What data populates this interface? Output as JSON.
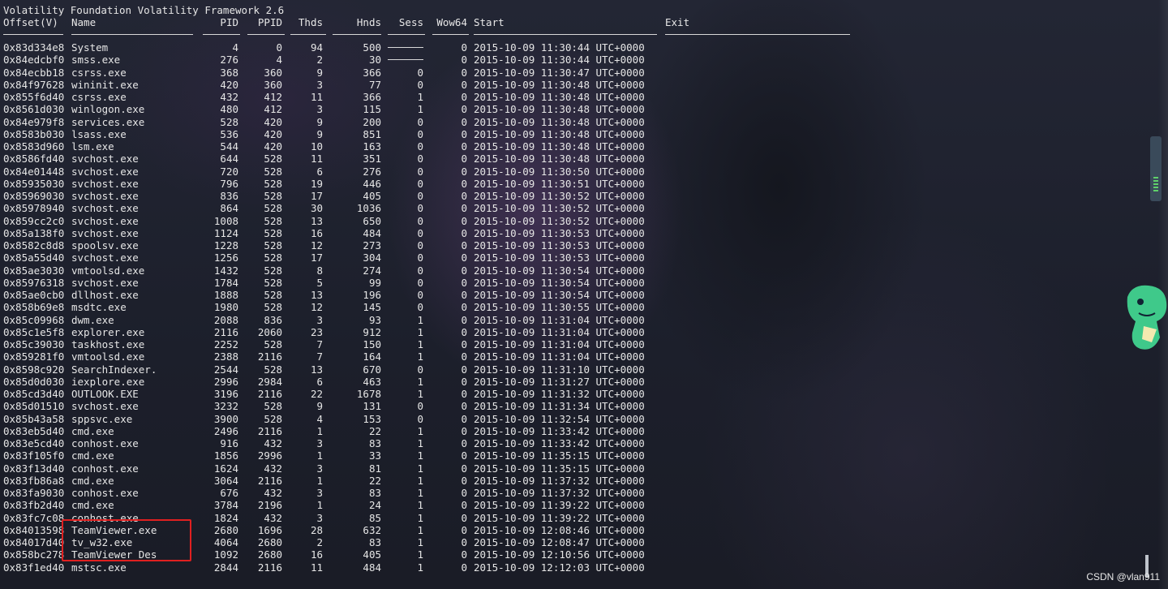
{
  "title_line": "Volatility Foundation Volatility Framework 2.6",
  "columns": [
    "Offset(V)",
    "Name",
    "PID",
    "PPID",
    "Thds",
    "Hnds",
    "Sess",
    "Wow64",
    "Start",
    "Exit"
  ],
  "rows": [
    [
      "0x83d334e8",
      "System",
      "4",
      "0",
      "94",
      "500",
      "",
      "0",
      "2015-10-09 11:30:44 UTC+0000"
    ],
    [
      "0x84edcbf0",
      "smss.exe",
      "276",
      "4",
      "2",
      "30",
      "",
      "0",
      "2015-10-09 11:30:44 UTC+0000"
    ],
    [
      "0x84ecbb18",
      "csrss.exe",
      "368",
      "360",
      "9",
      "366",
      "0",
      "0",
      "2015-10-09 11:30:47 UTC+0000"
    ],
    [
      "0x84f97628",
      "wininit.exe",
      "420",
      "360",
      "3",
      "77",
      "0",
      "0",
      "2015-10-09 11:30:48 UTC+0000"
    ],
    [
      "0x855f6d40",
      "csrss.exe",
      "432",
      "412",
      "11",
      "366",
      "1",
      "0",
      "2015-10-09 11:30:48 UTC+0000"
    ],
    [
      "0x8561d030",
      "winlogon.exe",
      "480",
      "412",
      "3",
      "115",
      "1",
      "0",
      "2015-10-09 11:30:48 UTC+0000"
    ],
    [
      "0x84e979f8",
      "services.exe",
      "528",
      "420",
      "9",
      "200",
      "0",
      "0",
      "2015-10-09 11:30:48 UTC+0000"
    ],
    [
      "0x8583b030",
      "lsass.exe",
      "536",
      "420",
      "9",
      "851",
      "0",
      "0",
      "2015-10-09 11:30:48 UTC+0000"
    ],
    [
      "0x8583d960",
      "lsm.exe",
      "544",
      "420",
      "10",
      "163",
      "0",
      "0",
      "2015-10-09 11:30:48 UTC+0000"
    ],
    [
      "0x8586fd40",
      "svchost.exe",
      "644",
      "528",
      "11",
      "351",
      "0",
      "0",
      "2015-10-09 11:30:48 UTC+0000"
    ],
    [
      "0x84e01448",
      "svchost.exe",
      "720",
      "528",
      "6",
      "276",
      "0",
      "0",
      "2015-10-09 11:30:50 UTC+0000"
    ],
    [
      "0x85935030",
      "svchost.exe",
      "796",
      "528",
      "19",
      "446",
      "0",
      "0",
      "2015-10-09 11:30:51 UTC+0000"
    ],
    [
      "0x85969030",
      "svchost.exe",
      "836",
      "528",
      "17",
      "405",
      "0",
      "0",
      "2015-10-09 11:30:52 UTC+0000"
    ],
    [
      "0x85978940",
      "svchost.exe",
      "864",
      "528",
      "30",
      "1036",
      "0",
      "0",
      "2015-10-09 11:30:52 UTC+0000"
    ],
    [
      "0x859cc2c0",
      "svchost.exe",
      "1008",
      "528",
      "13",
      "650",
      "0",
      "0",
      "2015-10-09 11:30:52 UTC+0000"
    ],
    [
      "0x85a138f0",
      "svchost.exe",
      "1124",
      "528",
      "16",
      "484",
      "0",
      "0",
      "2015-10-09 11:30:53 UTC+0000"
    ],
    [
      "0x8582c8d8",
      "spoolsv.exe",
      "1228",
      "528",
      "12",
      "273",
      "0",
      "0",
      "2015-10-09 11:30:53 UTC+0000"
    ],
    [
      "0x85a55d40",
      "svchost.exe",
      "1256",
      "528",
      "17",
      "304",
      "0",
      "0",
      "2015-10-09 11:30:53 UTC+0000"
    ],
    [
      "0x85ae3030",
      "vmtoolsd.exe",
      "1432",
      "528",
      "8",
      "274",
      "0",
      "0",
      "2015-10-09 11:30:54 UTC+0000"
    ],
    [
      "0x85976318",
      "svchost.exe",
      "1784",
      "528",
      "5",
      "99",
      "0",
      "0",
      "2015-10-09 11:30:54 UTC+0000"
    ],
    [
      "0x85ae0cb0",
      "dllhost.exe",
      "1888",
      "528",
      "13",
      "196",
      "0",
      "0",
      "2015-10-09 11:30:54 UTC+0000"
    ],
    [
      "0x858b69e8",
      "msdtc.exe",
      "1980",
      "528",
      "12",
      "145",
      "0",
      "0",
      "2015-10-09 11:30:55 UTC+0000"
    ],
    [
      "0x85c09968",
      "dwm.exe",
      "2088",
      "836",
      "3",
      "93",
      "1",
      "0",
      "2015-10-09 11:31:04 UTC+0000"
    ],
    [
      "0x85c1e5f8",
      "explorer.exe",
      "2116",
      "2060",
      "23",
      "912",
      "1",
      "0",
      "2015-10-09 11:31:04 UTC+0000"
    ],
    [
      "0x85c39030",
      "taskhost.exe",
      "2252",
      "528",
      "7",
      "150",
      "1",
      "0",
      "2015-10-09 11:31:04 UTC+0000"
    ],
    [
      "0x859281f0",
      "vmtoolsd.exe",
      "2388",
      "2116",
      "7",
      "164",
      "1",
      "0",
      "2015-10-09 11:31:04 UTC+0000"
    ],
    [
      "0x8598c920",
      "SearchIndexer.",
      "2544",
      "528",
      "13",
      "670",
      "0",
      "0",
      "2015-10-09 11:31:10 UTC+0000"
    ],
    [
      "0x85d0d030",
      "iexplore.exe",
      "2996",
      "2984",
      "6",
      "463",
      "1",
      "0",
      "2015-10-09 11:31:27 UTC+0000"
    ],
    [
      "0x85cd3d40",
      "OUTLOOK.EXE",
      "3196",
      "2116",
      "22",
      "1678",
      "1",
      "0",
      "2015-10-09 11:31:32 UTC+0000"
    ],
    [
      "0x85d01510",
      "svchost.exe",
      "3232",
      "528",
      "9",
      "131",
      "0",
      "0",
      "2015-10-09 11:31:34 UTC+0000"
    ],
    [
      "0x85b43a58",
      "sppsvc.exe",
      "3900",
      "528",
      "4",
      "153",
      "0",
      "0",
      "2015-10-09 11:32:54 UTC+0000"
    ],
    [
      "0x83eb5d40",
      "cmd.exe",
      "2496",
      "2116",
      "1",
      "22",
      "1",
      "0",
      "2015-10-09 11:33:42 UTC+0000"
    ],
    [
      "0x83e5cd40",
      "conhost.exe",
      "916",
      "432",
      "3",
      "83",
      "1",
      "0",
      "2015-10-09 11:33:42 UTC+0000"
    ],
    [
      "0x83f105f0",
      "cmd.exe",
      "1856",
      "2996",
      "1",
      "33",
      "1",
      "0",
      "2015-10-09 11:35:15 UTC+0000"
    ],
    [
      "0x83f13d40",
      "conhost.exe",
      "1624",
      "432",
      "3",
      "81",
      "1",
      "0",
      "2015-10-09 11:35:15 UTC+0000"
    ],
    [
      "0x83fb86a8",
      "cmd.exe",
      "3064",
      "2116",
      "1",
      "22",
      "1",
      "0",
      "2015-10-09 11:37:32 UTC+0000"
    ],
    [
      "0x83fa9030",
      "conhost.exe",
      "676",
      "432",
      "3",
      "83",
      "1",
      "0",
      "2015-10-09 11:37:32 UTC+0000"
    ],
    [
      "0x83fb2d40",
      "cmd.exe",
      "3784",
      "2196",
      "1",
      "24",
      "1",
      "0",
      "2015-10-09 11:39:22 UTC+0000"
    ],
    [
      "0x83fc7c08",
      "conhost.exe",
      "1824",
      "432",
      "3",
      "85",
      "1",
      "0",
      "2015-10-09 11:39:22 UTC+0000"
    ],
    [
      "0x84013598",
      "TeamViewer.exe",
      "2680",
      "1696",
      "28",
      "632",
      "1",
      "0",
      "2015-10-09 12:08:46 UTC+0000"
    ],
    [
      "0x84017d40",
      "tv_w32.exe",
      "4064",
      "2680",
      "2",
      "83",
      "1",
      "0",
      "2015-10-09 12:08:47 UTC+0000"
    ],
    [
      "0x858bc278",
      "TeamViewer_Des",
      "1092",
      "2680",
      "16",
      "405",
      "1",
      "0",
      "2015-10-09 12:10:56 UTC+0000"
    ],
    [
      "0x83f1ed40",
      "mstsc.exe",
      "2844",
      "2116",
      "11",
      "484",
      "1",
      "0",
      "2015-10-09 12:12:03 UTC+0000"
    ]
  ],
  "watermark": "CSDN @vlan911",
  "colors": {
    "highlight_box": "#e02020",
    "text": "#e6e6e6",
    "background": "#1f2230"
  }
}
